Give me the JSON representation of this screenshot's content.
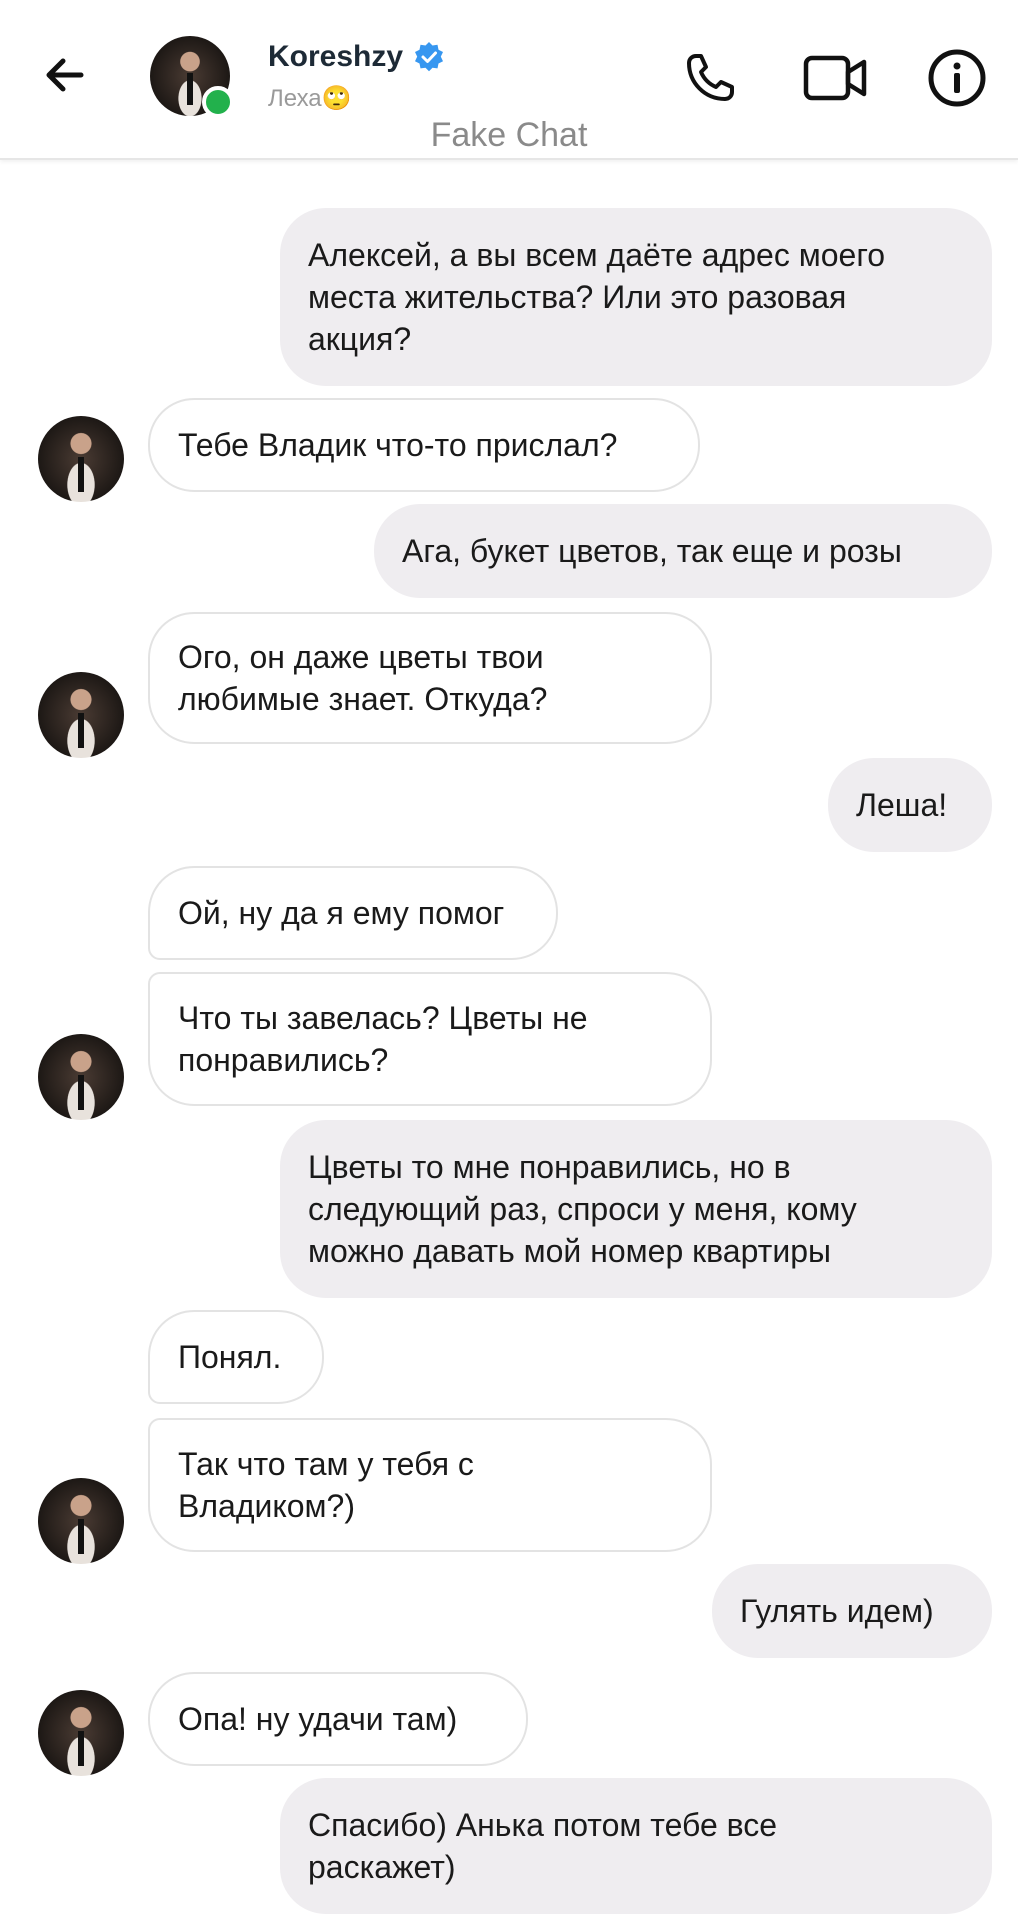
{
  "header": {
    "contact_name": "Koreshzy",
    "contact_subtitle": "Леха🙄",
    "watermark": "Fake Chat",
    "icons": [
      "back-arrow-icon",
      "verified-badge-icon",
      "phone-icon",
      "video-camera-icon",
      "info-icon"
    ]
  },
  "colors": {
    "outgoing_bubble": "#efedf0",
    "incoming_bubble": "#ffffff",
    "online": "#22b14c",
    "verified": "#3797f0"
  },
  "messages": [
    {
      "direction": "out",
      "text": "Алексей, а вы всем даёте адрес моего\nместа жительства? Или это разовая\nакция?"
    },
    {
      "direction": "in",
      "text": "Тебе Владик что-то прислал?"
    },
    {
      "direction": "out",
      "text": "Ага, букет цветов, так еще и розы"
    },
    {
      "direction": "in",
      "text": "Ого, он даже цветы твои\nлюбимые знает. Откуда?"
    },
    {
      "direction": "out",
      "text": "Леша!"
    },
    {
      "direction": "in",
      "text": "Ой, ну да я ему помог"
    },
    {
      "direction": "in",
      "text": "Что ты завелась? Цветы не\nпонравились?"
    },
    {
      "direction": "out",
      "text": "Цветы то мне понравились, но в\nследующий раз, спроси у меня, кому\nможно давать мой номер квартиры"
    },
    {
      "direction": "in",
      "text": "Понял."
    },
    {
      "direction": "in",
      "text": "Так что там у тебя с\nВладиком?)"
    },
    {
      "direction": "out",
      "text": "Гулять идем)"
    },
    {
      "direction": "in",
      "text": "Опа!  ну удачи там)"
    },
    {
      "direction": "out",
      "text": "Спасибо) Анька потом тебе все\nраскажет)"
    }
  ]
}
